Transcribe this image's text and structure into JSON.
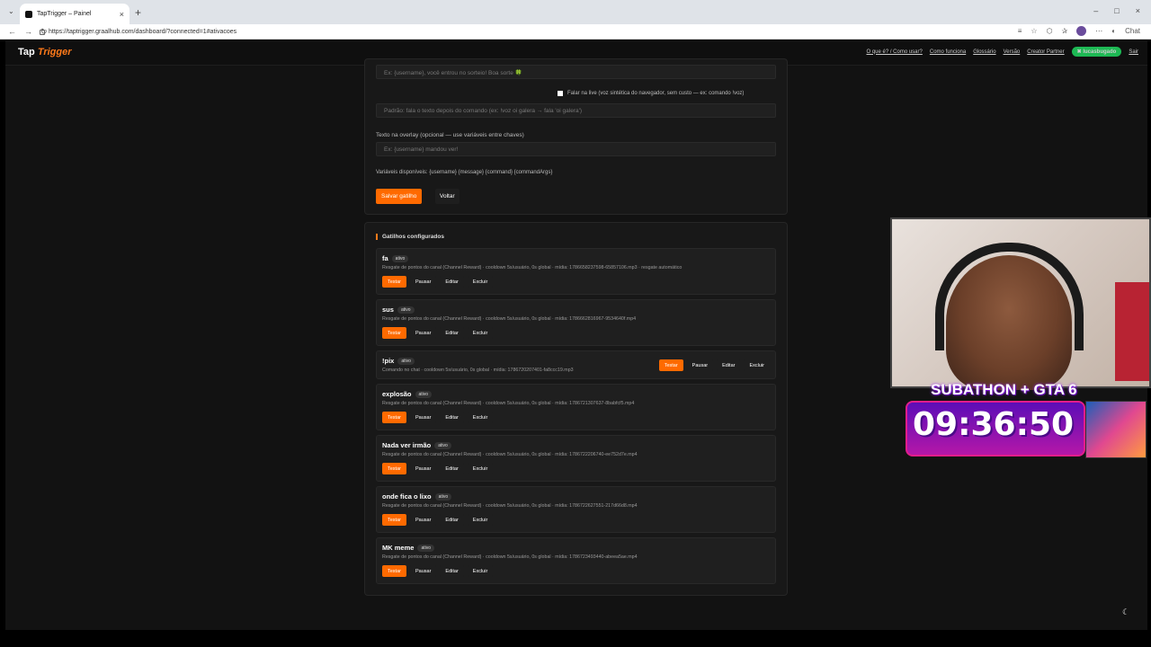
{
  "browser": {
    "tab_title": "TapTrigger – Painel",
    "url": "https://taptrigger.graalhub.com/dashboard/?connected=1#ativacoes",
    "chat_label": "Chat"
  },
  "header": {
    "logo_tap": "Tap",
    "logo_trigger": "Trigger",
    "nav": [
      "O que é? / Como usar?",
      "Como funciona",
      "Glossário",
      "Versão",
      "Creator Partner"
    ],
    "user": "lucasbugado",
    "exit": "Sair"
  },
  "form": {
    "msg_placeholder": "Ex: {username}, você entrou no sorteio! Boa sorte 🍀",
    "speak_label": "Falar na live (voz sintética do navegador, sem custo — ex: comando !voz)",
    "speak_placeholder": "Padrão: fala o texto depois do comando (ex: !voz oi galera → fala 'oi galera')",
    "overlay_label": "Texto na overlay (opcional — use variáveis entre chaves)",
    "overlay_placeholder": "Ex: {username} mandou ver!",
    "vars": "Variáveis disponíveis: {username} {message} {command} {commandArgs}",
    "save": "Salvar gatilho",
    "back": "Voltar"
  },
  "triggers": {
    "title": "Gatilhos configurados",
    "actions": [
      "Testar",
      "Pausar",
      "Editar",
      "Excluir"
    ],
    "status": "ativo",
    "items": [
      {
        "name": "fa",
        "desc": "Resgate de pontos do canal (Channel Reward) · cooldown 5s/usuário, 0s global · mídia: 1786658237598-65857106.mp3 · resgate automático"
      },
      {
        "name": "sus",
        "desc": "Resgate de pontos do canal (Channel Reward) · cooldown 5s/usuário, 0s global · mídia: 1786662816967-9534640f.mp4"
      },
      {
        "name": "!pix",
        "desc": "Comando no chat · cooldown 5s/usuário, 0s global · mídia: 1786720207401-fa8ccc19.mp3"
      },
      {
        "name": "explosão",
        "desc": "Resgate de pontos do canal (Channel Reward) · cooldown 5s/usuário, 0s global · mídia: 1786721307637-8babfcf5.mp4"
      },
      {
        "name": "Nada ver irmão",
        "desc": "Resgate de pontos do canal (Channel Reward) · cooldown 5s/usuário, 0s global · mídia: 1786722206740-ee752d7e.mp4"
      },
      {
        "name": "onde fica o lixo",
        "desc": "Resgate de pontos do canal (Channel Reward) · cooldown 5s/usuário, 0s global · mídia: 1786722627551-217d66d8.mp4"
      },
      {
        "name": "MK meme",
        "desc": "Resgate de pontos do canal (Channel Reward) · cooldown 5s/usuário, 0s global · mídia: 1786723493440-abeea5ae.mp4"
      }
    ]
  },
  "overlay": {
    "subathon": "SUBATHON + GTA 6",
    "timer": "09:36:50"
  }
}
